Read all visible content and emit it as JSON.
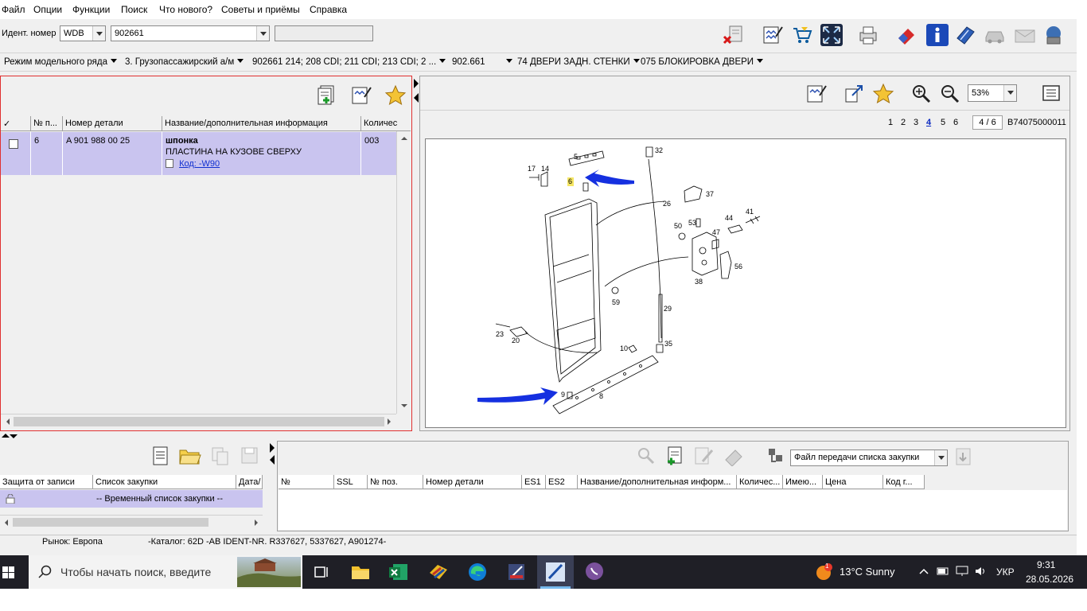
{
  "menu": [
    "Файл",
    "Опции",
    "Функции",
    "Поиск",
    "Что нового?",
    "Советы и приёмы",
    "Справка"
  ],
  "ident": {
    "label": "Идент. номер",
    "prefix": "WDB",
    "number": "902661"
  },
  "breadcrumb": [
    "Режим модельного ряда",
    "3. Грузопассажирский а/м",
    "902661 214; 208 CDI; 211 CDI; 213 CDI; 2 ...",
    "902.661",
    "74 ДВЕРИ ЗАДН. СТЕНКИ",
    "075 БЛОКИРОВКА ДВЕРИ"
  ],
  "parts_table": {
    "headers": [
      "✓",
      "№ п...",
      "Номер детали",
      "Название/дополнительная информация",
      "Количес"
    ],
    "rows": [
      {
        "pos": "6",
        "part_number": "A 901 988 00 25",
        "name": "шпонка",
        "subname": "ПЛАСТИНА НА КУЗОВЕ СВЕРХУ",
        "code": "Код: -W90",
        "qty": "003"
      }
    ]
  },
  "viewer": {
    "zoom": "53%",
    "pages": [
      "1",
      "2",
      "3",
      "4",
      "5",
      "6"
    ],
    "current_page": "4",
    "page_counter": "4 / 6",
    "drawing_id": "B74075000011"
  },
  "diagram_labels": [
    "5",
    "32",
    "17",
    "14",
    "6",
    "26",
    "37",
    "50",
    "53",
    "44",
    "41",
    "47",
    "56",
    "38",
    "59",
    "29",
    "23",
    "20",
    "10",
    "35",
    "9",
    "8"
  ],
  "shopping": {
    "headers": [
      "Защита от записи",
      "Список закупки",
      "Дата/"
    ],
    "row": "-- Временный список закупки --"
  },
  "transfer_file": "Файл передачи списка закупки",
  "order_table": {
    "headers": [
      "№",
      "SSL",
      "№ поз.",
      "Номер детали",
      "ES1",
      "ES2",
      "Название/дополнительная информ...",
      "Количес...",
      "Имею...",
      "Цена",
      "Код г..."
    ]
  },
  "status": {
    "market": "Рынок: Европа",
    "catalog": "-Каталог: 62D -AB IDENT-NR. R337627, 5337627, A901274-"
  },
  "taskbar": {
    "search_placeholder": "Чтобы начать поиск, введите",
    "weather": "13°C  Sunny",
    "lang": "УКР",
    "time": "9:31",
    "date": "28.05.2026",
    "badge": "1"
  }
}
